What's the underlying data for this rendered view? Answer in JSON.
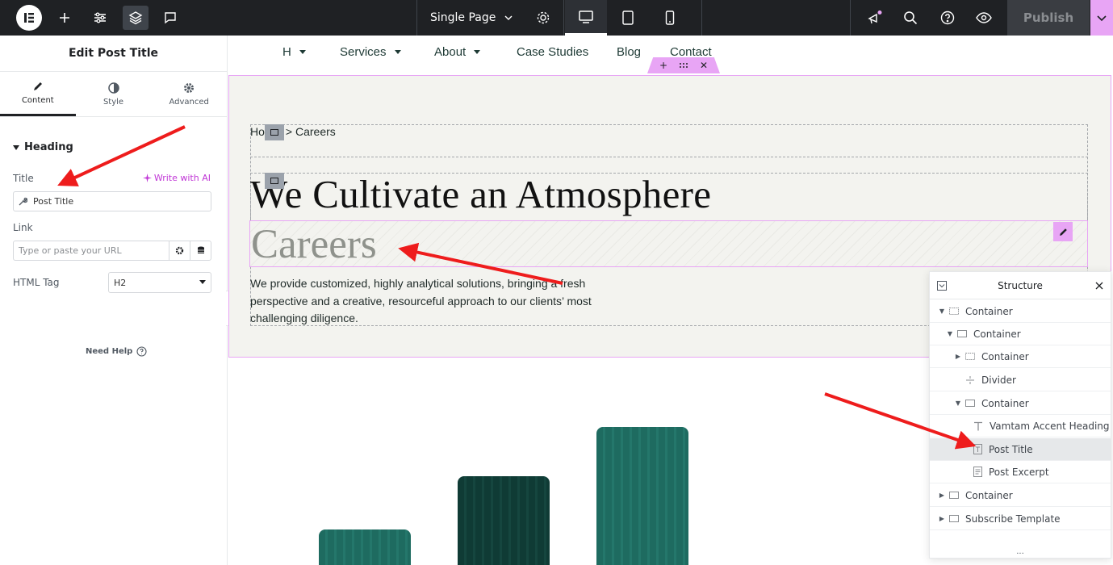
{
  "topbar": {
    "page_selector": "Single Page",
    "publish": "Publish"
  },
  "panel": {
    "title": "Edit Post Title",
    "tabs": [
      {
        "label": "Content"
      },
      {
        "label": "Style"
      },
      {
        "label": "Advanced"
      }
    ],
    "section": "Heading",
    "title_label": "Title",
    "write_ai": "Write with AI",
    "title_value": "Post Title",
    "link_label": "Link",
    "link_placeholder": "Type or paste your URL",
    "html_tag_label": "HTML Tag",
    "html_tag_value": "H2",
    "need_help": "Need Help"
  },
  "nav": {
    "items": [
      {
        "label": "H",
        "dropdown": true
      },
      {
        "label": "Services",
        "dropdown": true
      },
      {
        "label": "About",
        "dropdown": true
      },
      {
        "label": "Case Studies",
        "dropdown": false
      },
      {
        "label": "Blog",
        "dropdown": false
      },
      {
        "label": "Contact",
        "dropdown": false
      }
    ]
  },
  "hero": {
    "crumb_home": "Ho",
    "crumb_rest": "> Careers",
    "accent_heading": "We Cultivate an Atmosphere",
    "post_title": "Careers",
    "excerpt": "We provide customized, highly analytical solutions, bringing a fresh perspective and a creative, resourceful approach to our clients’ most challenging diligence."
  },
  "structure": {
    "title": "Structure",
    "rows": [
      {
        "label": "Container"
      },
      {
        "label": "Container"
      },
      {
        "label": "Container"
      },
      {
        "label": "Divider"
      },
      {
        "label": "Container"
      },
      {
        "label": "Vamtam Accent Heading"
      },
      {
        "label": "Post Title"
      },
      {
        "label": "Post Excerpt"
      },
      {
        "label": "Container"
      },
      {
        "label": "Subscribe Template"
      }
    ],
    "more": "..."
  },
  "colors": {
    "accent_pink": "#e8a5f5",
    "ai_purple": "#c036d6",
    "arrow_red": "#ee1c1c",
    "bar_green": "#1e6b60"
  }
}
